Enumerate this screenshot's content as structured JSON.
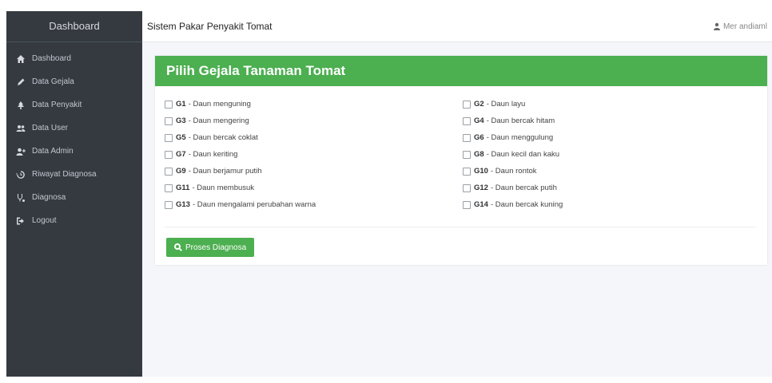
{
  "sidebar": {
    "brand": "Dashboard",
    "items": [
      {
        "label": "Dashboard",
        "icon": "home-icon"
      },
      {
        "label": "Data Gejala",
        "icon": "pen-icon"
      },
      {
        "label": "Data Penyakit",
        "icon": "tree-icon"
      },
      {
        "label": "Data User",
        "icon": "users-icon"
      },
      {
        "label": "Data Admin",
        "icon": "user-plus-icon"
      },
      {
        "label": "Riwayat Diagnosa",
        "icon": "history-icon"
      },
      {
        "label": "Diagnosa",
        "icon": "stethoscope-icon"
      },
      {
        "label": "Logout",
        "icon": "logout-icon"
      }
    ]
  },
  "topbar": {
    "title": "Sistem Pakar Penyakit Tomat",
    "user": "Mer andiaml"
  },
  "card": {
    "title": "Pilih Gejala Tanaman Tomat",
    "symptoms": [
      {
        "code": "G1",
        "label": "- Daun menguning"
      },
      {
        "code": "G2",
        "label": "- Daun layu"
      },
      {
        "code": "G3",
        "label": "- Daun mengering"
      },
      {
        "code": "G4",
        "label": "- Daun bercak hitam"
      },
      {
        "code": "G5",
        "label": "- Daun bercak coklat"
      },
      {
        "code": "G6",
        "label": "- Daun menggulung"
      },
      {
        "code": "G7",
        "label": "- Daun keriting"
      },
      {
        "code": "G8",
        "label": "- Daun kecil dan kaku"
      },
      {
        "code": "G9",
        "label": "- Daun berjamur putih"
      },
      {
        "code": "G10",
        "label": "- Daun rontok"
      },
      {
        "code": "G11",
        "label": "- Daun membusuk"
      },
      {
        "code": "G12",
        "label": "- Daun bercak putih"
      },
      {
        "code": "G13",
        "label": "- Daun mengalami perubahan warna"
      },
      {
        "code": "G14",
        "label": "- Daun bercak kuning"
      }
    ],
    "button_label": "Proses Diagnosa"
  },
  "colors": {
    "accent": "#4caf50",
    "sidebar": "#343a40"
  }
}
